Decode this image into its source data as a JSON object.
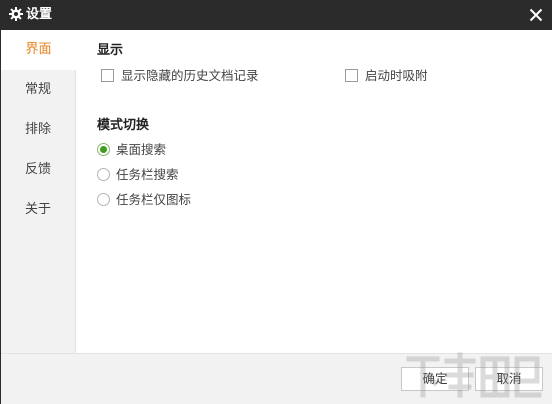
{
  "window": {
    "title": "设置",
    "title_icon": "gear-icon",
    "close_icon": "close-icon"
  },
  "sidebar": {
    "items": [
      {
        "label": "界面",
        "active": true
      },
      {
        "label": "常规",
        "active": false
      },
      {
        "label": "排除",
        "active": false
      },
      {
        "label": "反馈",
        "active": false
      },
      {
        "label": "关于",
        "active": false
      }
    ]
  },
  "display": {
    "title": "显示",
    "show_hidden_history": {
      "label": "显示隐藏的历史文档记录",
      "checked": false
    },
    "startup_snap": {
      "label": "启动时吸附",
      "checked": false
    }
  },
  "mode": {
    "title": "模式切换",
    "options": [
      {
        "label": "桌面搜索",
        "selected": true
      },
      {
        "label": "任务栏搜索",
        "selected": false
      },
      {
        "label": "任务栏仅图标",
        "selected": false
      }
    ]
  },
  "footer": {
    "confirm_label": "确定",
    "cancel_label": "取消"
  },
  "colors": {
    "titlebar": "#2b2b2b",
    "active_nav": "#e6821e",
    "radio_checked": "#3f9d1e",
    "sidebar_bg": "#f2f2f2"
  }
}
